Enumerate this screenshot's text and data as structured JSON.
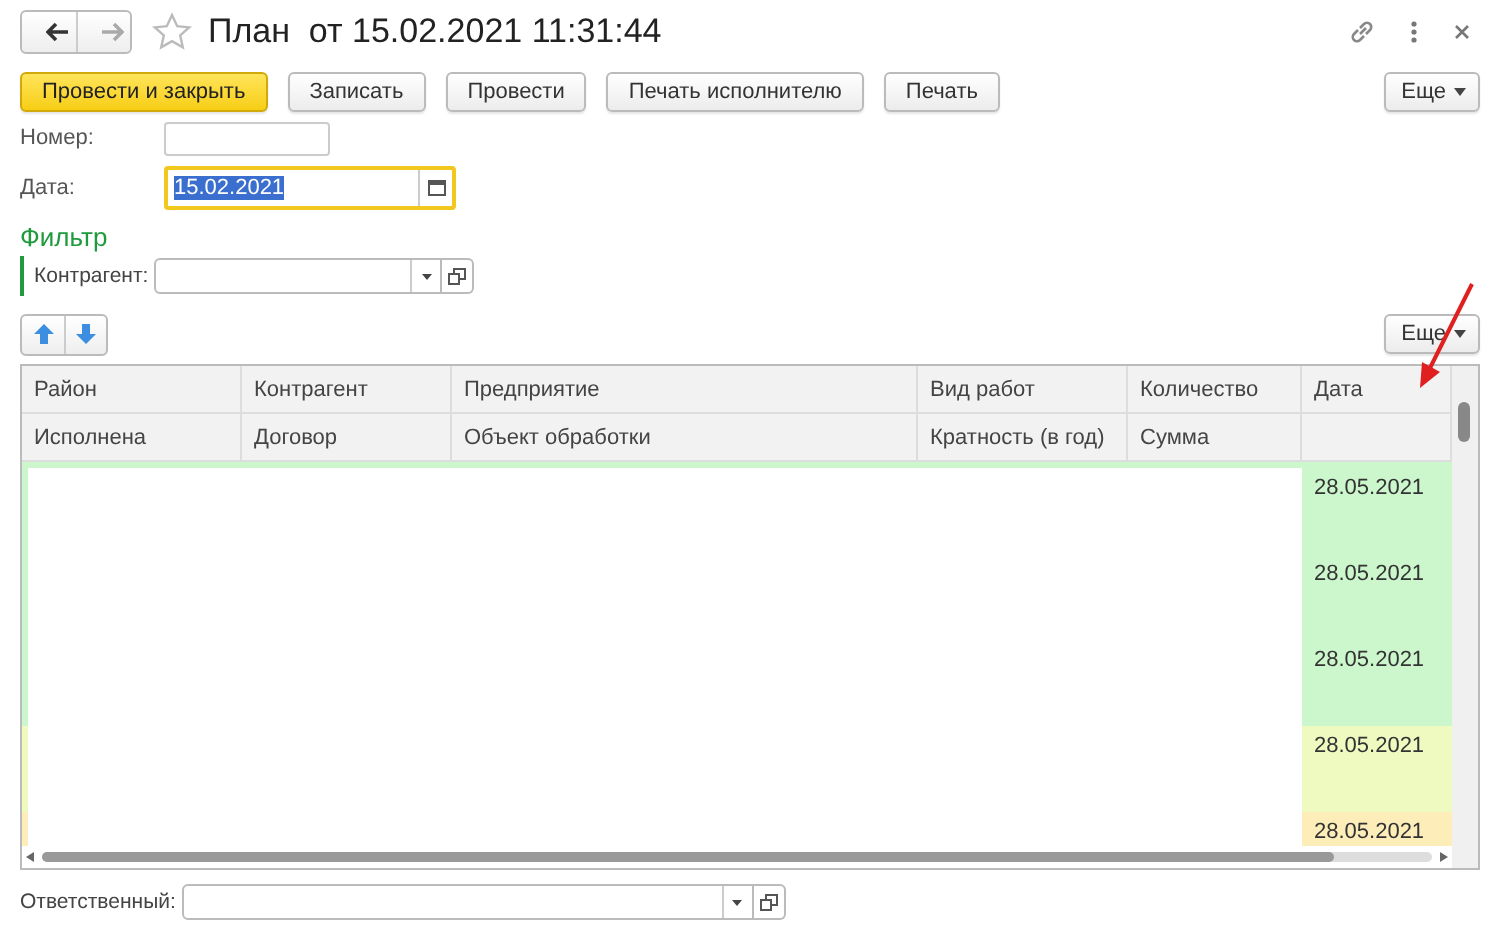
{
  "window": {
    "title": "План  от 15.02.2021 11:31:44"
  },
  "toolbar": [
    {
      "label": "Провести и закрыть",
      "kind": "primary"
    },
    {
      "label": "Записать",
      "kind": "normal"
    },
    {
      "label": "Провести",
      "kind": "normal"
    },
    {
      "label": "Печать исполнителю",
      "kind": "normal"
    },
    {
      "label": "Печать",
      "kind": "normal"
    }
  ],
  "more_button": "Еще",
  "fields": [
    {
      "label": "Номер:",
      "kind": "text",
      "focused": false
    },
    {
      "label": "Дата:",
      "kind": "date",
      "value": "15.02.2021",
      "focused": true
    }
  ],
  "filter": {
    "title": "Фильтр",
    "label": "Контрагент:"
  },
  "table_more_button": "Еще",
  "table": {
    "header_rows": [
      [
        "Район",
        "Контрагент",
        "Предприятие",
        "Вид работ",
        "Количество",
        "Дата"
      ],
      [
        "Исполнена",
        "Договор",
        "Объект обработки",
        "Кратность (в год)",
        "Сумма",
        ""
      ]
    ],
    "rows": [
      {
        "date": "28.05.2021",
        "color": "#ccf7cc"
      },
      {
        "date": "28.05.2021",
        "color": "#ccf7cc"
      },
      {
        "date": "28.05.2021",
        "color": "#ccf7cc"
      },
      {
        "date": "28.05.2021",
        "color": "#effac0"
      },
      {
        "date": "28.05.2021",
        "color": "#fdeeb9"
      }
    ]
  },
  "responsible": {
    "label": "Ответственный:"
  }
}
